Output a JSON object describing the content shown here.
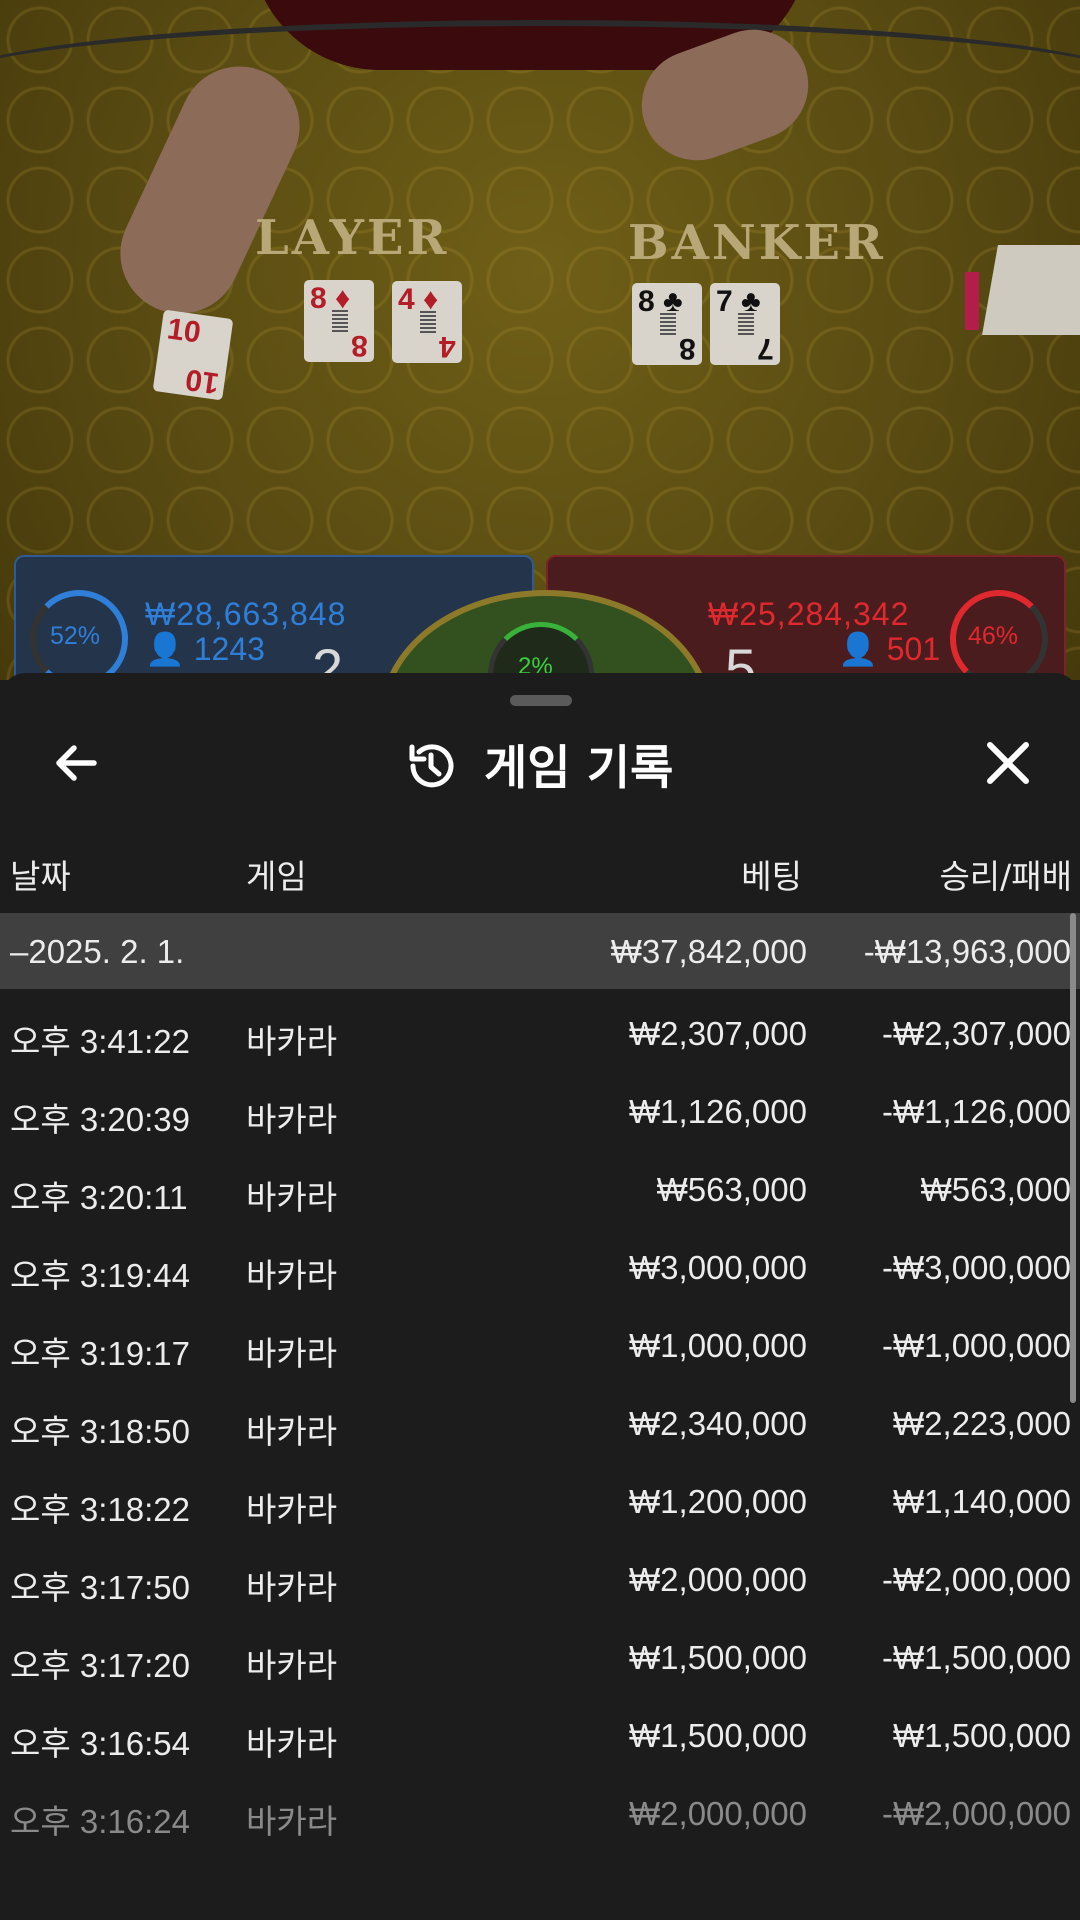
{
  "table": {
    "player_label": "LAYER",
    "banker_label": "BANKER",
    "player_cards": [
      {
        "rank": "10",
        "suit": "♦",
        "color": "red"
      },
      {
        "rank": "8",
        "suit": "♦",
        "color": "red"
      },
      {
        "rank": "4",
        "suit": "♦",
        "color": "red"
      }
    ],
    "banker_cards": [
      {
        "rank": "8",
        "suit": "♣",
        "color": "black"
      },
      {
        "rank": "7",
        "suit": "♣",
        "color": "black"
      }
    ],
    "player_stats": {
      "percent": "52%",
      "amount": "₩28,663,848",
      "bettors": "1243",
      "score": "2"
    },
    "banker_stats": {
      "percent": "46%",
      "amount": "₩25,284,342",
      "bettors": "501",
      "score": "5"
    },
    "tie_percent": "2%"
  },
  "history": {
    "title": "게임 기록",
    "back_icon": "arrow-left-icon",
    "history_icon": "history-clock-icon",
    "close_icon": "close-icon",
    "columns": {
      "date": "날짜",
      "game": "게임",
      "bet": "베팅",
      "result": "승리/패배"
    },
    "summary": {
      "date": "–2025. 2. 1.",
      "bet": "₩37,842,000",
      "result": "-₩13,963,000"
    },
    "rows": [
      {
        "time": "오후 3:41:22",
        "game": "바카라",
        "bet": "₩2,307,000",
        "result": "-₩2,307,000"
      },
      {
        "time": "오후 3:20:39",
        "game": "바카라",
        "bet": "₩1,126,000",
        "result": "-₩1,126,000"
      },
      {
        "time": "오후 3:20:11",
        "game": "바카라",
        "bet": "₩563,000",
        "result": "₩563,000"
      },
      {
        "time": "오후 3:19:44",
        "game": "바카라",
        "bet": "₩3,000,000",
        "result": "-₩3,000,000"
      },
      {
        "time": "오후 3:19:17",
        "game": "바카라",
        "bet": "₩1,000,000",
        "result": "-₩1,000,000"
      },
      {
        "time": "오후 3:18:50",
        "game": "바카라",
        "bet": "₩2,340,000",
        "result": "₩2,223,000"
      },
      {
        "time": "오후 3:18:22",
        "game": "바카라",
        "bet": "₩1,200,000",
        "result": "₩1,140,000"
      },
      {
        "time": "오후 3:17:50",
        "game": "바카라",
        "bet": "₩2,000,000",
        "result": "-₩2,000,000"
      },
      {
        "time": "오후 3:17:20",
        "game": "바카라",
        "bet": "₩1,500,000",
        "result": "-₩1,500,000"
      },
      {
        "time": "오후 3:16:54",
        "game": "바카라",
        "bet": "₩1,500,000",
        "result": "₩1,500,000"
      },
      {
        "time": "오후 3:16:24",
        "game": "바카라",
        "bet": "₩2,000,000",
        "result": "-₩2,000,000"
      }
    ]
  },
  "colors": {
    "player": "#2f7fd8",
    "banker": "#e0282f",
    "tie": "#3ad13d",
    "sheet_bg": "#1c1c1c",
    "summary_bg": "#404040"
  }
}
